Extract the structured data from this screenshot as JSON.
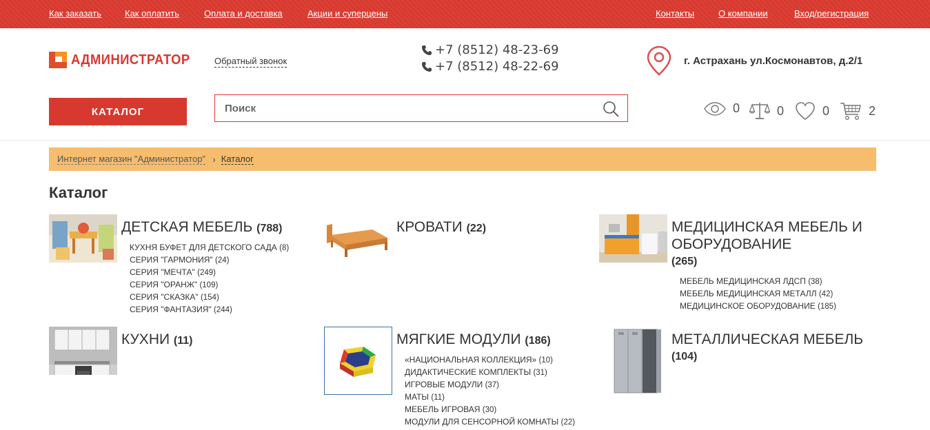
{
  "topnav": {
    "left": [
      "Как заказать",
      "Как оплатить",
      "Оплата и доставка",
      "Акции и суперцены"
    ],
    "right": [
      "Контакты",
      "О компании",
      "Вход/регистрация"
    ]
  },
  "header": {
    "logo_text": "АДМИНИСТРАТОР",
    "callback": "Обратный звонок",
    "phones": [
      "+7 (8512) 48-23-69",
      "+7 (8512) 48-22-69"
    ],
    "address": "г. Астрахань ул.Космонавтов, д.2/1"
  },
  "catalog_button": "КАТАЛОГ",
  "search": {
    "placeholder": "Поиск"
  },
  "counters": {
    "viewed": "0",
    "compare": "0",
    "favorites": "0",
    "cart": "2"
  },
  "breadcrumb": {
    "home": "Интернет магазин \"Администратор\"",
    "current": "Каталог"
  },
  "page_title": "Каталог",
  "categories": [
    {
      "title": "ДЕТСКАЯ МЕБЕЛЬ",
      "count": "(788)",
      "items": [
        {
          "label": "КУХНЯ БУФЕТ ДЛЯ ДЕТСКОГО САДА",
          "count": "(8)"
        },
        {
          "label": "СЕРИЯ \"ГАРМОНИЯ\"",
          "count": "(24)"
        },
        {
          "label": "СЕРИЯ \"МЕЧТА\"",
          "count": "(249)"
        },
        {
          "label": "СЕРИЯ \"ОРАНЖ\"",
          "count": "(109)"
        },
        {
          "label": "СЕРИЯ \"СКАЗКА\"",
          "count": "(154)"
        },
        {
          "label": "СЕРИЯ \"ФАНТАЗИЯ\"",
          "count": "(244)"
        }
      ]
    },
    {
      "title": "КРОВАТИ",
      "count": "(22)",
      "items": []
    },
    {
      "title_line1": "МЕДИЦИНСКАЯ МЕБЕЛЬ И",
      "title_line2": "ОБОРУДОВАНИЕ",
      "count": "(265)",
      "items": [
        {
          "label": "МЕБЕЛЬ МЕДИЦИНСКАЯ ЛДСП",
          "count": "(38)"
        },
        {
          "label": "МЕБЕЛЬ МЕДИЦИНСКАЯ МЕТАЛЛ",
          "count": "(42)"
        },
        {
          "label": "МЕДИЦИНСКОЕ ОБОРУДОВАНИЕ",
          "count": "(185)"
        }
      ]
    },
    {
      "title": "КУХНИ",
      "count": "(11)",
      "items": []
    },
    {
      "title": "МЯГКИЕ МОДУЛИ",
      "count": "(186)",
      "items": [
        {
          "label": "«НАЦИОНАЛЬНАЯ КОЛЛЕКЦИЯ»",
          "count": "(10)"
        },
        {
          "label": "ДИДАКТИЧЕСКИЕ КОМПЛЕКТЫ",
          "count": "(31)"
        },
        {
          "label": "ИГРОВЫЕ МОДУЛИ",
          "count": "(37)"
        },
        {
          "label": "МАТЫ",
          "count": "(11)"
        },
        {
          "label": "МЕБЕЛЬ ИГРОВАЯ",
          "count": "(30)"
        },
        {
          "label": "МОДУЛИ ДЛЯ СЕНСОРНОЙ КОМНАТЫ",
          "count": "(22)"
        }
      ]
    },
    {
      "title": "МЕТАЛЛИЧЕСКАЯ МЕБЕЛЬ",
      "count": "(104)",
      "items": []
    }
  ],
  "colors": {
    "brand_red": "#d8392e",
    "breadcrumb_bg": "#f6bd6e",
    "logo_orange": "#f7941d"
  }
}
